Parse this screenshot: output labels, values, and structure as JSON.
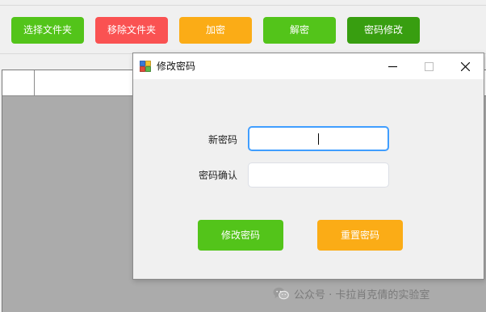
{
  "toolbar": {
    "buttons": [
      {
        "label": "选择文件夹",
        "color": "#53c41a"
      },
      {
        "label": "移除文件夹",
        "color": "#fa5252"
      },
      {
        "label": "加密",
        "color": "#fbac16"
      },
      {
        "label": "解密",
        "color": "#53c41a"
      },
      {
        "label": "密码修改",
        "color": "#389e10"
      }
    ]
  },
  "dialog": {
    "title": "修改密码",
    "new_password_label": "新密码",
    "new_password_value": "",
    "confirm_label": "密码确认",
    "confirm_value": "",
    "modify_button": "修改密码",
    "reset_button": "重置密码",
    "modify_color": "#53c41a",
    "reset_color": "#fbac16"
  },
  "watermark": {
    "text": "公众号 · 卡拉肖克倩的实验室"
  }
}
